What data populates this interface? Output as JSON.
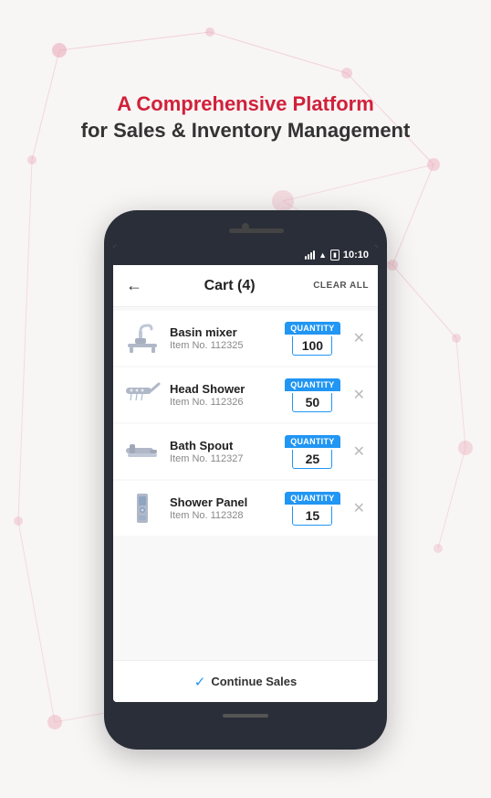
{
  "background": {
    "color": "#f5f5f5"
  },
  "header": {
    "line1": "A Comprehensive Platform",
    "line2": "for Sales & Inventory Management"
  },
  "phone": {
    "statusBar": {
      "time": "10:10"
    },
    "appHeader": {
      "title": "Cart (4)",
      "clearAll": "CLEAR ALL",
      "backIcon": "←"
    },
    "cartItems": [
      {
        "id": 1,
        "name": "Basin mixer",
        "itemNo": "Item No. 112325",
        "quantity": 100,
        "quantityLabel": "Quantity",
        "iconType": "basin-mixer"
      },
      {
        "id": 2,
        "name": "Head Shower",
        "itemNo": "Item No. 112326",
        "quantity": 50,
        "quantityLabel": "Quantity",
        "iconType": "head-shower"
      },
      {
        "id": 3,
        "name": "Bath Spout",
        "itemNo": "Item No. 112327",
        "quantity": 25,
        "quantityLabel": "Quantity",
        "iconType": "bath-spout"
      },
      {
        "id": 4,
        "name": "Shower Panel",
        "itemNo": "Item No. 112328",
        "quantity": 15,
        "quantityLabel": "Quantity",
        "iconType": "shower-panel"
      }
    ],
    "footer": {
      "label": "Continue Sales",
      "checkIcon": "✓"
    }
  }
}
